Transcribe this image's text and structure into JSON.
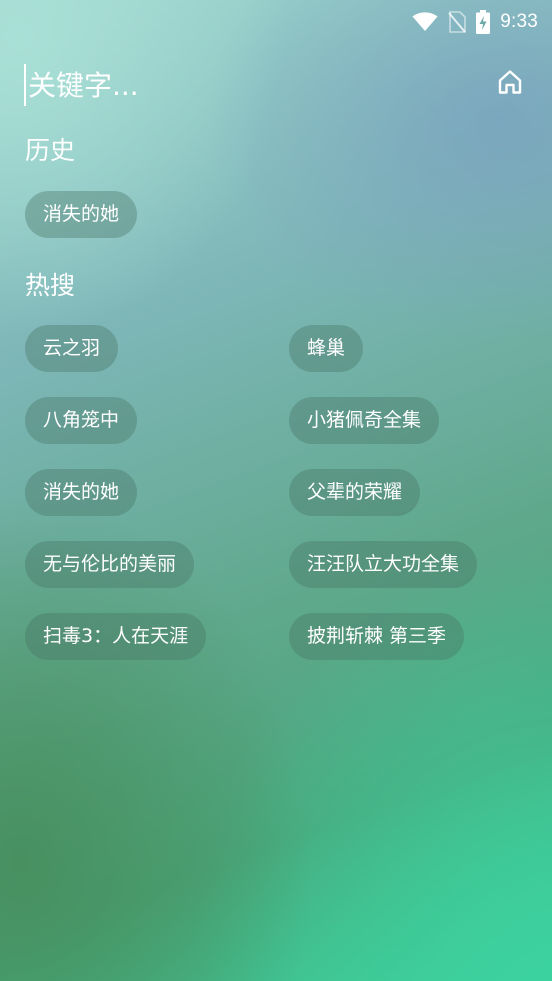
{
  "status_bar": {
    "time": "9:33",
    "icons": [
      "wifi-icon",
      "no-sim-icon",
      "battery-charging-icon"
    ]
  },
  "search": {
    "placeholder": "关键字...",
    "home_icon": "home-icon"
  },
  "history": {
    "title": "历史",
    "items": [
      "消失的她"
    ]
  },
  "hot_search": {
    "title": "热搜",
    "items": [
      "云之羽",
      "蜂巢",
      "八角笼中",
      "小猪佩奇全集",
      "消失的她",
      "父辈的荣耀",
      "无与伦比的美丽",
      "汪汪队立大功全集",
      "扫毒3：人在天涯",
      "披荆斩棘 第三季"
    ]
  }
}
